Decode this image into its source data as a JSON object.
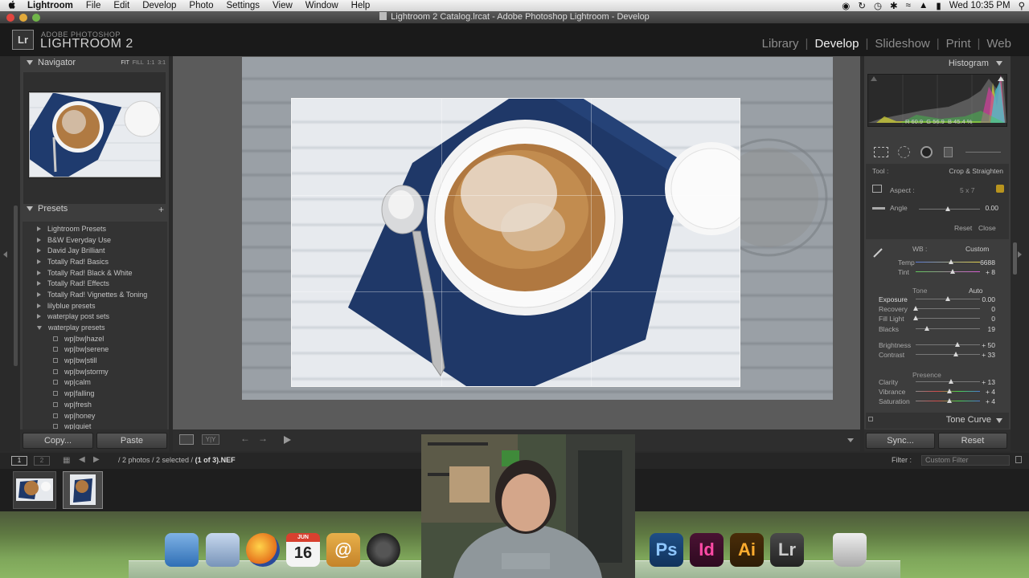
{
  "menubar": {
    "app": "Lightroom",
    "items": [
      "File",
      "Edit",
      "Develop",
      "Photo",
      "Settings",
      "View",
      "Window",
      "Help"
    ],
    "clock": "Wed 10:35 PM"
  },
  "window": {
    "title": "Lightroom 2 Catalog.lrcat - Adobe Photoshop Lightroom - Develop"
  },
  "identity": {
    "badge": "Lr",
    "small": "ADOBE PHOTOSHOP",
    "big": "LIGHTROOM 2"
  },
  "modules": [
    "Library",
    "Develop",
    "Slideshow",
    "Print",
    "Web"
  ],
  "active_module": "Develop",
  "navigator": {
    "title": "Navigator",
    "options": [
      "FIT",
      "FILL",
      "1:1",
      "3:1"
    ]
  },
  "presets": {
    "title": "Presets",
    "folders": [
      "Lightroom Presets",
      "B&W Everyday Use",
      "David Jay Brilliant",
      "Totally Rad! Basics",
      "Totally Rad! Black & White",
      "Totally Rad! Effects",
      "Totally Rad! Vignettes & Toning",
      "lilyblue presets",
      "waterplay post sets"
    ],
    "open_folder": "waterplay presets",
    "items": [
      "wp|bw|hazel",
      "wp|bw|serene",
      "wp|bw|still",
      "wp|bw|stormy",
      "wp|calm",
      "wp|falling",
      "wp|fresh",
      "wp|honey",
      "wp|quiet"
    ]
  },
  "left_buttons": {
    "copy": "Copy...",
    "paste": "Paste"
  },
  "histogram": {
    "title": "Histogram",
    "r": "R 60.9",
    "g": "G 56.9",
    "b": "B 45.4 %"
  },
  "crop": {
    "tool_label": "Tool :",
    "tool_value": "Crop & Straighten",
    "aspect_label": "Aspect :",
    "aspect_value": "5 x 7",
    "angle_label": "Angle",
    "angle_value": "0.00",
    "reset": "Reset",
    "close": "Close"
  },
  "basic": {
    "wb_label": "WB :",
    "wb_value": "Custom",
    "temp": {
      "label": "Temp",
      "value": "6688",
      "pos": 0.55
    },
    "tint": {
      "label": "Tint",
      "value": "+ 8",
      "pos": 0.58
    },
    "tone_label": "Tone",
    "tone_auto": "Auto",
    "exposure": {
      "label": "Exposure",
      "value": "0.00",
      "pos": 0.5
    },
    "recovery": {
      "label": "Recovery",
      "value": "0",
      "pos": 0.0
    },
    "fill_light": {
      "label": "Fill Light",
      "value": "0",
      "pos": 0.0
    },
    "blacks": {
      "label": "Blacks",
      "value": "19",
      "pos": 0.18
    },
    "brightness": {
      "label": "Brightness",
      "value": "+ 50",
      "pos": 0.65
    },
    "contrast": {
      "label": "Contrast",
      "value": "+ 33",
      "pos": 0.62
    },
    "presence_label": "Presence",
    "clarity": {
      "label": "Clarity",
      "value": "+ 13",
      "pos": 0.55
    },
    "vibrance": {
      "label": "Vibrance",
      "value": "+ 4",
      "pos": 0.52
    },
    "saturation": {
      "label": "Saturation",
      "value": "+ 4",
      "pos": 0.52
    }
  },
  "tone_curve": "Tone Curve",
  "right_buttons": {
    "sync": "Sync...",
    "reset": "Reset"
  },
  "filmstrip": {
    "pages": [
      "1",
      "2"
    ],
    "info": "/ 2 photos / 2 selected /",
    "file": "(1 of 3).NEF",
    "filter_label": "Filter :",
    "filter_value": "Custom Filter"
  },
  "dock": {
    "calendar_day": "16",
    "calendar_month": "JUN",
    "apps": [
      "Ps",
      "Id",
      "Ai",
      "Lr"
    ]
  },
  "colors": {
    "accent_active": "#f0f0f0",
    "panel": "#3d3d3d",
    "photoshop": "#2b6fb5",
    "indesign": "#c8287a",
    "illustrator": "#e28a1c"
  }
}
